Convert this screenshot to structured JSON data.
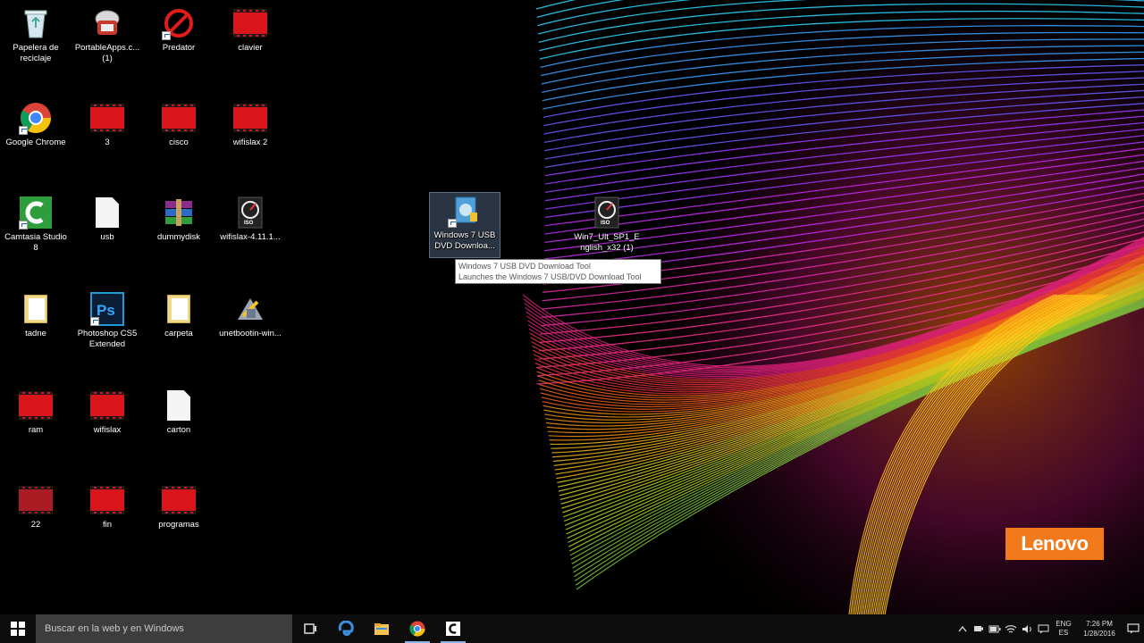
{
  "desktop": {
    "icons": [
      {
        "label": "Papelera de reciclaje",
        "icon": "recycle-bin-icon"
      },
      {
        "label": "PortableApps.c... (1)",
        "icon": "portableapps-icon"
      },
      {
        "label": "Predator",
        "icon": "predator-icon"
      },
      {
        "label": "clavier",
        "icon": "video-file-icon"
      },
      {
        "label": "Google Chrome",
        "icon": "chrome-icon"
      },
      {
        "label": "3",
        "icon": "video-file-icon"
      },
      {
        "label": "cisco",
        "icon": "video-file-icon"
      },
      {
        "label": "wifislax 2",
        "icon": "video-file-icon"
      },
      {
        "label": "Camtasia Studio 8",
        "icon": "camtasia-icon"
      },
      {
        "label": "usb",
        "icon": "document-icon"
      },
      {
        "label": "dummydisk",
        "icon": "winrar-archive-icon"
      },
      {
        "label": "wifislax-4.11.1...",
        "icon": "iso-disc-icon"
      },
      {
        "label": "tadne",
        "icon": "folder-icon"
      },
      {
        "label": "Photoshop CS5 Extended",
        "icon": "photoshop-icon"
      },
      {
        "label": "carpeta",
        "icon": "folder-icon"
      },
      {
        "label": "unetbootin-win...",
        "icon": "unetbootin-icon"
      },
      {
        "label": "ram",
        "icon": "video-file-icon"
      },
      {
        "label": "wifislax",
        "icon": "video-file-icon"
      },
      {
        "label": "carton",
        "icon": "document-icon"
      },
      {
        "label": "22",
        "icon": "video-file-icon"
      },
      {
        "label": "fin",
        "icon": "video-file-icon"
      },
      {
        "label": "programas",
        "icon": "video-file-icon"
      },
      {
        "label": "Windows 7 USB DVD Downloa...",
        "icon": "usb-dvd-tool-icon",
        "selected": true
      },
      {
        "label": "Win7_Ult_SP1_English_x32 (1)",
        "icon": "iso-disc-icon"
      }
    ]
  },
  "tooltip": {
    "line1": "Windows 7 USB DVD Download Tool",
    "line2": "Launches the Windows 7 USB/DVD Download Tool"
  },
  "wallpaper": {
    "brand": "Lenovo",
    "brand_color": "#f27a1a"
  },
  "taskbar": {
    "search_placeholder": "Buscar en la web y en Windows",
    "pinned": [
      "task-view-icon",
      "edge-icon",
      "file-explorer-icon",
      "chrome-icon",
      "camtasia-icon"
    ],
    "tray": {
      "language_top": "ENG",
      "language_bottom": "ES",
      "time": "7:26 PM",
      "date": "1/28/2016"
    }
  },
  "colors": {
    "taskbar_bg": "#0d0d0d",
    "search_bg": "#3d3d3d",
    "video_red": "#d9151b"
  }
}
